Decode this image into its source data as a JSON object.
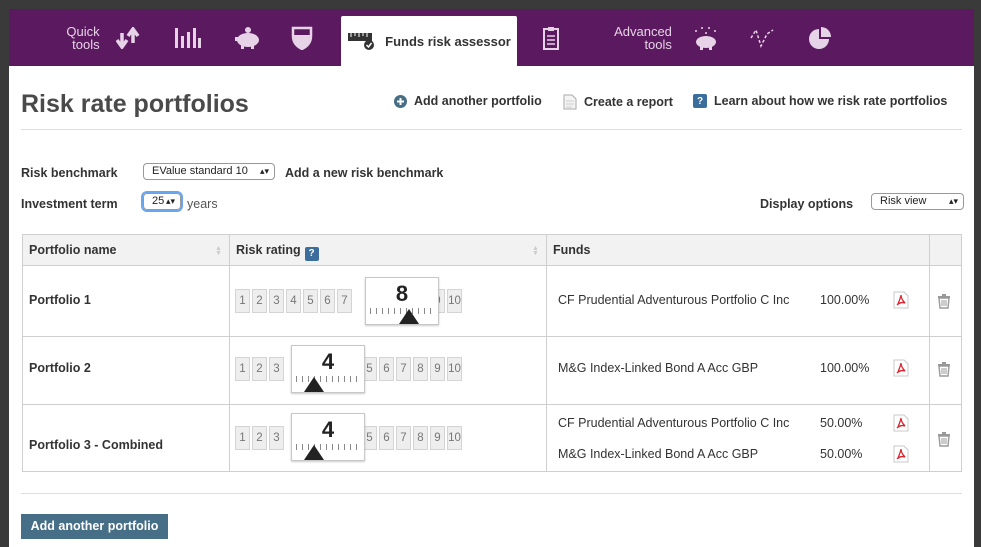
{
  "toolbar": {
    "quick_tools": "Quick\ntools",
    "active_tab": "Funds risk assessor",
    "advanced_tools": "Advanced\ntools"
  },
  "colors": {
    "brand": "#5b1a5f",
    "button": "#466e86",
    "help": "#3b6e9c"
  },
  "header": {
    "title": "Risk rate portfolios",
    "add_portfolio": "Add another portfolio",
    "create_report": "Create a report",
    "learn": "Learn about how we risk rate portfolios"
  },
  "form": {
    "benchmark_label": "Risk benchmark",
    "benchmark_value": "EValue standard 10",
    "add_benchmark": "Add a new risk benchmark",
    "term_label": "Investment term",
    "term_value": "25",
    "term_unit": "years",
    "display_label": "Display options",
    "display_value": "Risk view"
  },
  "table": {
    "headers": {
      "name": "Portfolio name",
      "rating": "Risk rating",
      "funds": "Funds",
      "help": "?"
    },
    "scale": [
      "1",
      "2",
      "3",
      "4",
      "5",
      "6",
      "7",
      "8",
      "9",
      "10"
    ],
    "rows": [
      {
        "name": "Portfolio 1",
        "rating": "8",
        "rating_value": 8,
        "funds": [
          {
            "fund": "CF Prudential Adventurous Portfolio C Inc",
            "pct": "100.00%"
          }
        ]
      },
      {
        "name": "Portfolio 2",
        "rating": "4",
        "rating_value": 4,
        "funds": [
          {
            "fund": "M&G Index-Linked Bond A Acc GBP",
            "pct": "100.00%"
          }
        ]
      },
      {
        "name": "Portfolio 3 - Combined",
        "rating": "4",
        "rating_value": 4,
        "funds": [
          {
            "fund": "CF Prudential Adventurous Portfolio C Inc",
            "pct": "50.00%"
          },
          {
            "fund": "M&G Index-Linked Bond A Acc GBP",
            "pct": "50.00%"
          }
        ]
      }
    ]
  },
  "footer": {
    "add_button": "Add another portfolio"
  }
}
